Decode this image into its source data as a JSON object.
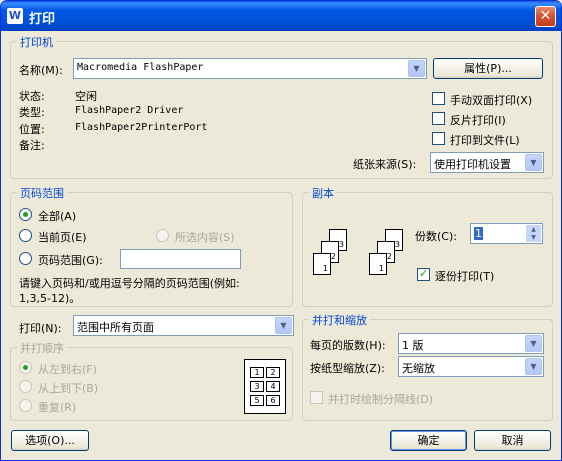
{
  "window": {
    "title": "打印",
    "app_icon": "W"
  },
  "printer": {
    "group_title": "打印机",
    "name_label": "名称(M):",
    "name_value": "Macromedia FlashPaper",
    "properties_button": "属性(P)...",
    "status_label": "状态:",
    "status_value": "空闲",
    "type_label": "类型:",
    "type_value": "FlashPaper2 Driver",
    "where_label": "位置:",
    "where_value": "FlashPaper2PrinterPort",
    "comment_label": "备注:",
    "manual_duplex": "手动双面打印(X)",
    "mirror": "反片打印(I)",
    "print_to_file": "打印到文件(L)",
    "paper_source_label": "纸张来源(S):",
    "paper_source_value": "使用打印机设置"
  },
  "page_range": {
    "group_title": "页码范围",
    "all": "全部(A)",
    "current_page": "当前页(E)",
    "selection": "所选内容(S)",
    "pages": "页码范围(G):",
    "hint": "请键入页码和/或用逗号分隔的页码范围(例如:",
    "hint2": "1,3,5-12)。"
  },
  "copies": {
    "group_title": "副本",
    "count_label": "份数(C):",
    "count_value": "1",
    "collate": "逐份打印(T)",
    "stack_pages": [
      "1",
      "2",
      "3"
    ]
  },
  "print_what": {
    "label": "打印(N):",
    "value": "范围中所有页面"
  },
  "order": {
    "group_title": "并打顺序",
    "left_to_right": "从左到右(F)",
    "top_to_bottom": "从上到下(B)",
    "repeat": "重复(R)",
    "grid": [
      "1",
      "2",
      "3",
      "4",
      "5",
      "6"
    ]
  },
  "zoom": {
    "group_title": "并打和缩放",
    "pages_per_sheet_label": "每页的版数(H):",
    "pages_per_sheet_value": "1 版",
    "scale_label": "按纸型缩放(Z):",
    "scale_value": "无缩放",
    "draw_borders": "并打时绘制分隔线(D)"
  },
  "footer": {
    "options": "选项(O)...",
    "ok": "确定",
    "cancel": "取消"
  }
}
